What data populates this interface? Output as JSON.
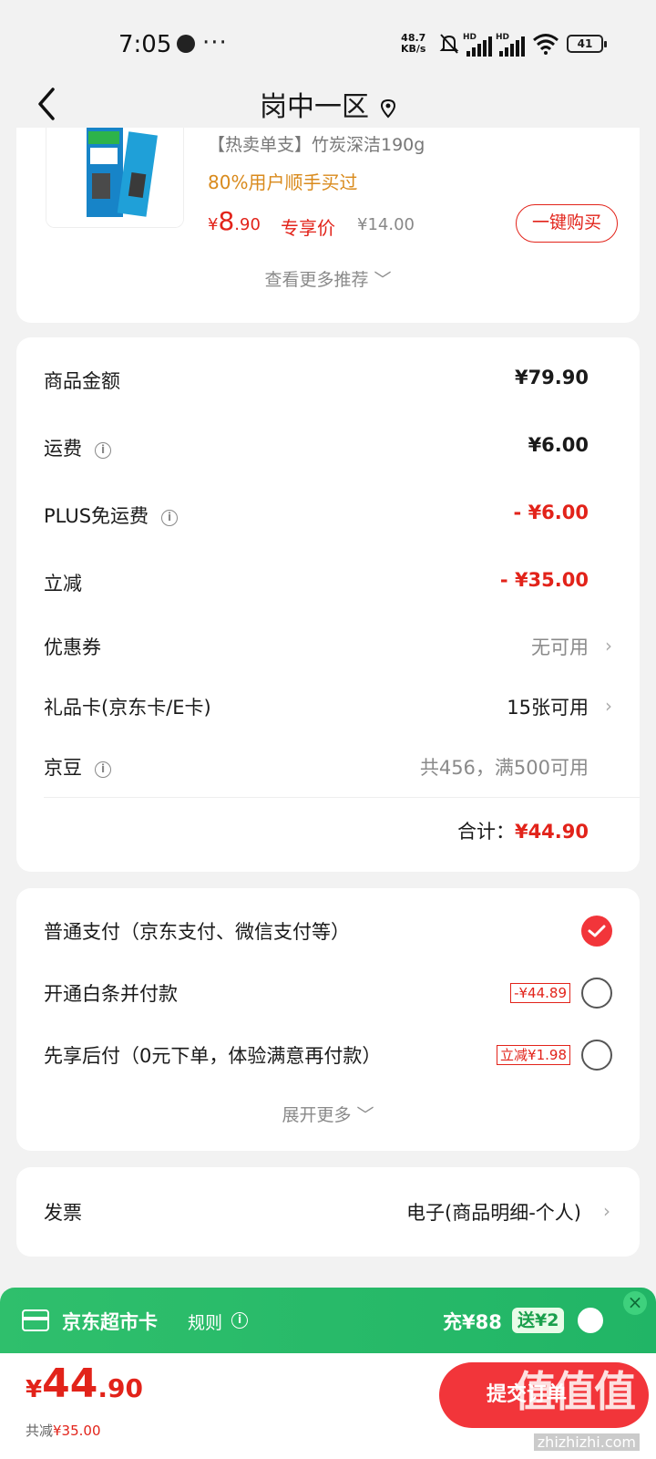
{
  "status": {
    "time": "7:05",
    "speed_top": "48.7",
    "speed_bottom": "KB/s",
    "battery": "41"
  },
  "header": {
    "title": "岗中一区"
  },
  "recommend": {
    "product_name": "【热卖单支】竹炭深洁190g",
    "hint": "80%用户顺手买过",
    "price_yen": "¥",
    "price_int": "8",
    "price_dec": ".90",
    "exclusive": "专享价",
    "original": "¥14.00",
    "buy_label": "一键购买",
    "more_label": "查看更多推荐 ﹀"
  },
  "summary": {
    "rows": [
      {
        "label": "商品金额",
        "value": "¥79.90"
      },
      {
        "label": "运费",
        "value": "¥6.00"
      },
      {
        "label": "PLUS免运费",
        "value": "- ¥6.00"
      },
      {
        "label": "立减",
        "value": "- ¥35.00"
      },
      {
        "label": "优惠券",
        "value": "无可用"
      },
      {
        "label": "礼品卡(京东卡/E卡)",
        "value": "15张可用"
      },
      {
        "label": "京豆",
        "value": "共456，满500可用"
      }
    ],
    "total_label": "合计：",
    "total_value": "¥44.90"
  },
  "payment": {
    "options": [
      {
        "label": "普通支付（京东支付、微信支付等）",
        "tag": ""
      },
      {
        "label": "开通白条并付款",
        "tag": "-¥44.89"
      },
      {
        "label": "先享后付（0元下单，体验满意再付款）",
        "tag": "立减¥1.98"
      }
    ],
    "more_label": "展开更多 ﹀"
  },
  "invoice": {
    "label": "发票",
    "value": "电子(商品明细-个人)"
  },
  "promo": {
    "name": "京东超市卡",
    "rules": "规则",
    "recharge": "充¥88",
    "gift": "送¥2",
    "close": "×"
  },
  "bottom": {
    "price_yen": "¥",
    "price_int": "44",
    "price_dec": ".90",
    "saved_label": "共减",
    "saved_value": "¥35.00",
    "submit_label": "提交订单"
  },
  "watermark": {
    "main": "值值值",
    "sub": "zhizhizhi.com"
  },
  "colors": {
    "accent": "#e2231a",
    "promo_green": "#2fbf6c"
  }
}
